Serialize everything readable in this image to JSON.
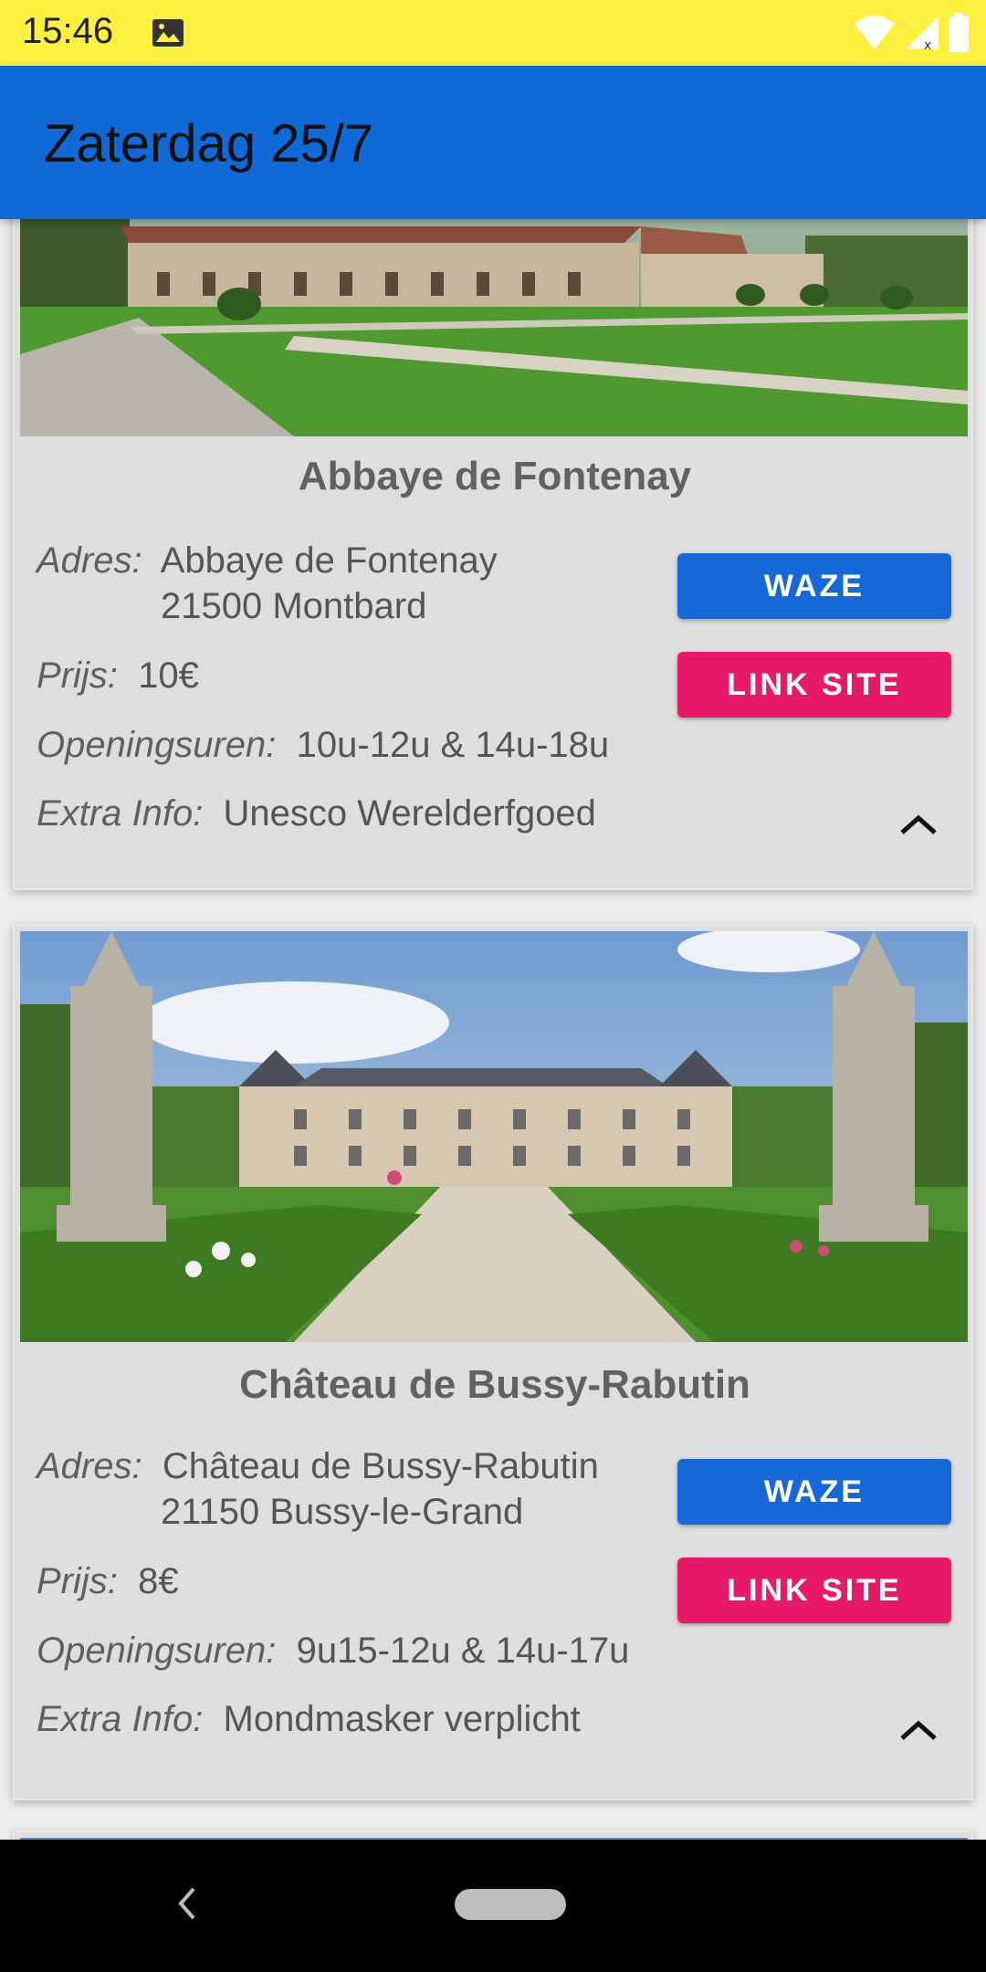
{
  "status_bar": {
    "time": "15:46",
    "icons": [
      "image-icon",
      "wifi-icon",
      "signal-icon",
      "battery-icon"
    ]
  },
  "app_bar": {
    "title": "Zaterdag 25/7"
  },
  "cards": [
    {
      "title": "Abbaye de Fontenay",
      "address_label": "Adres:",
      "address_line1": "Abbaye de Fontenay",
      "address_line2": "21500 Montbard",
      "price_label": "Prijs:",
      "price": "10€",
      "hours_label": "Openingsuren:",
      "hours": "10u-12u & 14u-18u",
      "extra_label": "Extra Info:",
      "extra": "Unesco Werelderfgoed",
      "waze_label": "WAZE",
      "link_label": "LINK SITE"
    },
    {
      "title": "Château de Bussy-Rabutin",
      "address_label": "Adres:",
      "address_line1": "Château de Bussy-Rabutin",
      "address_line2": "21150 Bussy-le-Grand",
      "price_label": "Prijs:",
      "price": "8€",
      "hours_label": "Openingsuren:",
      "hours": "9u15-12u & 14u-17u",
      "extra_label": "Extra Info:",
      "extra": "Mondmasker verplicht",
      "waze_label": "WAZE",
      "link_label": "LINK SITE"
    }
  ],
  "colors": {
    "status_bar": "#fdf03f",
    "app_bar": "#0f6ad8",
    "waze_button": "#1568d8",
    "link_button": "#e8196a",
    "card_background": "#dedede"
  },
  "nav_bar": {
    "icons": [
      "back-icon",
      "home-pill-icon"
    ]
  }
}
